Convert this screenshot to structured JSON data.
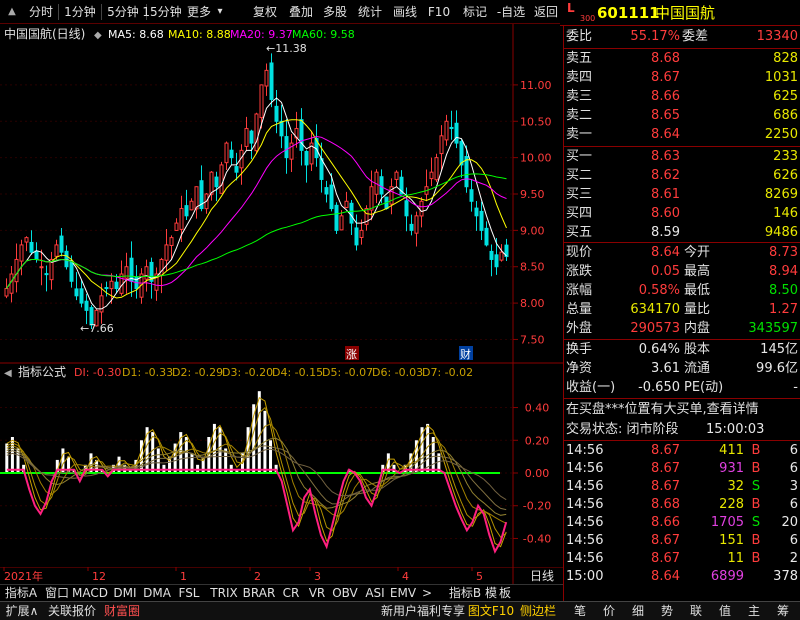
{
  "toolbar": {
    "tabs": [
      "分时",
      "1分钟",
      "5分钟",
      "15分钟",
      "更多"
    ],
    "more_arrow": "▾",
    "actions": [
      "复权",
      "叠加",
      "多股",
      "统计",
      "画线",
      "F10",
      "标记",
      "-自选",
      "返回"
    ]
  },
  "stock": {
    "market_badge": "L",
    "market_sub": "300",
    "code": "601111",
    "name": "中国国航"
  },
  "main_chart": {
    "title": "中国国航(日线)",
    "ma_labels": [
      {
        "text": "MA5: 8.68",
        "color": "#ffffff"
      },
      {
        "text": "MA10: 8.88",
        "color": "#ffff00"
      },
      {
        "text": "MA20: 9.37",
        "color": "#ff00ff"
      },
      {
        "text": "MA60: 9.58",
        "color": "#00ff00"
      }
    ],
    "high_label": "11.38",
    "low_label": "7.66",
    "y_ticks": [
      "11.00",
      "10.50",
      "10.00",
      "9.50",
      "9.00",
      "8.50",
      "8.00",
      "7.50"
    ],
    "markers": [
      "涨",
      "财"
    ]
  },
  "chart_data": [
    {
      "type": "candlestick",
      "title": "中国国航(日线)",
      "ylim": [
        7.3,
        11.7
      ],
      "y_ticks": [
        7.5,
        8.0,
        8.5,
        9.0,
        9.5,
        10.0,
        10.5,
        11.0
      ],
      "high": 11.38,
      "low": 7.66,
      "ma": {
        "MA5": 8.68,
        "MA10": 8.88,
        "MA20": 9.37,
        "MA60": 9.58
      },
      "closes": [
        8.2,
        8.4,
        8.6,
        8.8,
        8.9,
        8.7,
        8.6,
        8.5,
        8.4,
        8.6,
        8.8,
        8.7,
        8.5,
        8.3,
        8.1,
        8.0,
        7.9,
        7.7,
        7.9,
        8.1,
        8.2,
        8.3,
        8.2,
        8.4,
        8.5,
        8.3,
        8.2,
        8.4,
        8.5,
        8.3,
        8.4,
        8.6,
        8.8,
        8.9,
        9.1,
        9.3,
        9.2,
        9.4,
        9.6,
        9.3,
        9.5,
        9.8,
        9.6,
        9.9,
        10.2,
        10.0,
        9.8,
        10.1,
        10.4,
        10.2,
        10.6,
        11.0,
        11.2,
        10.8,
        10.5,
        10.3,
        10.0,
        10.2,
        10.4,
        10.1,
        9.9,
        10.2,
        10.0,
        9.7,
        9.5,
        9.3,
        9.0,
        9.2,
        9.4,
        9.1,
        8.8,
        9.0,
        9.3,
        9.6,
        9.8,
        9.5,
        9.3,
        9.6,
        9.8,
        9.5,
        9.2,
        9.0,
        9.2,
        9.4,
        9.6,
        9.8,
        10.0,
        10.3,
        10.5,
        10.4,
        10.2,
        9.9,
        9.6,
        9.4,
        9.2,
        9.0,
        8.8,
        8.6,
        8.5,
        8.7,
        8.64
      ]
    },
    {
      "type": "bar",
      "title": "指标公式",
      "ylim": [
        -0.55,
        0.55
      ],
      "y_ticks": [
        0.4,
        0.2,
        0.0,
        -0.2,
        -0.4
      ],
      "labels": [
        {
          "text": "DI: -0.30",
          "color": "#ff3c3c"
        },
        {
          "text": "D1: -0.33",
          "color": "#c8a000"
        },
        {
          "text": "D2: -0.29",
          "color": "#c8a000"
        },
        {
          "text": "D3: -0.20",
          "color": "#c8a000"
        },
        {
          "text": "D4: -0.15",
          "color": "#c8a000"
        },
        {
          "text": "D5: -0.07",
          "color": "#c8a000"
        },
        {
          "text": "D6: -0.03",
          "color": "#c8a000"
        },
        {
          "text": "D7: -0.02",
          "color": "#c8a000"
        }
      ],
      "di": [
        0.18,
        0.22,
        0.15,
        0.05,
        -0.1,
        -0.2,
        -0.25,
        -0.18,
        -0.05,
        0.08,
        0.15,
        0.1,
        0.02,
        -0.05,
        0.05,
        0.12,
        0.08,
        0.02,
        -0.02,
        0.05,
        0.1,
        0.05,
        0.02,
        0.08,
        0.2,
        0.28,
        0.25,
        0.15,
        0.05,
        0.1,
        0.18,
        0.25,
        0.22,
        0.12,
        0.05,
        0.1,
        0.22,
        0.3,
        0.28,
        0.15,
        0.05,
        0.02,
        0.12,
        0.28,
        0.42,
        0.5,
        0.38,
        0.2,
        0.05,
        -0.05,
        -0.2,
        -0.35,
        -0.3,
        -0.15,
        -0.1,
        -0.25,
        -0.38,
        -0.45,
        -0.32,
        -0.18,
        -0.05,
        0.02,
        0.0,
        -0.05,
        -0.15,
        -0.2,
        -0.1,
        0.05,
        0.12,
        0.05,
        0.0,
        0.05,
        0.12,
        0.2,
        0.28,
        0.3,
        0.22,
        0.12,
        0.0,
        -0.1,
        -0.2,
        -0.28,
        -0.35,
        -0.3,
        -0.2,
        -0.25,
        -0.38,
        -0.48,
        -0.42,
        -0.3
      ]
    }
  ],
  "indicator": {
    "title": "指标公式",
    "y_ticks": [
      "0.40",
      "0.20",
      "0.00",
      "-0.20",
      "-0.40"
    ]
  },
  "x_axis": {
    "labels": [
      "2021年",
      "12",
      "1",
      "2",
      "3",
      "4",
      "5"
    ],
    "period": "日线"
  },
  "bottom_tabs": [
    "指标A",
    "窗口",
    "MACD",
    "DMI",
    "DMA",
    "FSL",
    "TRIX",
    "BRAR",
    "CR",
    "VR",
    "OBV",
    "ASI",
    "EMV",
    "指标B",
    "模",
    "板"
  ],
  "footer": {
    "left": [
      "扩展∧",
      "关联报价",
      "财富圈"
    ],
    "promo": "新用户福利专享",
    "mid": [
      "图文F10",
      "侧边栏"
    ],
    "right": [
      "笔",
      "价",
      "细",
      "势",
      "联",
      "值",
      "主",
      "筹"
    ]
  },
  "quote": {
    "wei_bi": {
      "label": "委比",
      "value": "55.17%"
    },
    "wei_cha": {
      "label": "委差",
      "value": "13340"
    },
    "asks": [
      {
        "label": "卖五",
        "price": "8.68",
        "vol": "828"
      },
      {
        "label": "卖四",
        "price": "8.67",
        "vol": "1031"
      },
      {
        "label": "卖三",
        "price": "8.66",
        "vol": "625"
      },
      {
        "label": "卖二",
        "price": "8.65",
        "vol": "686"
      },
      {
        "label": "卖一",
        "price": "8.64",
        "vol": "2250"
      }
    ],
    "bids": [
      {
        "label": "买一",
        "price": "8.63",
        "vol": "233"
      },
      {
        "label": "买二",
        "price": "8.62",
        "vol": "626"
      },
      {
        "label": "买三",
        "price": "8.61",
        "vol": "8269"
      },
      {
        "label": "买四",
        "price": "8.60",
        "vol": "146"
      },
      {
        "label": "买五",
        "price": "8.59",
        "vol": "9486"
      }
    ],
    "stats": [
      {
        "l1": "现价",
        "v1": "8.64",
        "c1": "red",
        "l2": "今开",
        "v2": "8.73",
        "c2": "red"
      },
      {
        "l1": "涨跌",
        "v1": "0.05",
        "c1": "red",
        "l2": "最高",
        "v2": "8.94",
        "c2": "red"
      },
      {
        "l1": "涨幅",
        "v1": "0.58%",
        "c1": "red",
        "l2": "最低",
        "v2": "8.50",
        "c2": "green"
      },
      {
        "l1": "总量",
        "v1": "634170",
        "c1": "yellow",
        "l2": "量比",
        "v2": "1.27",
        "c2": "red"
      },
      {
        "l1": "外盘",
        "v1": "290573",
        "c1": "red",
        "l2": "内盘",
        "v2": "343597",
        "c2": "green"
      }
    ],
    "stats2": [
      {
        "l1": "换手",
        "v1": "0.64%",
        "l2": "股本",
        "v2": "145亿"
      },
      {
        "l1": "净资",
        "v1": "3.61",
        "l2": "流通",
        "v2": "99.6亿"
      },
      {
        "l1": "收益(一)",
        "v1": "-0.650",
        "l2": "PE(动)",
        "v2": "-"
      }
    ],
    "notice": "在买盘***位置有大买单,查看详情",
    "status_label": "交易状态: 闭市阶段",
    "status_time": "15:00:03",
    "ticks": [
      {
        "t": "14:56",
        "p": "8.67",
        "v": "411",
        "s": "B",
        "n": "6"
      },
      {
        "t": "14:56",
        "p": "8.67",
        "v": "931",
        "s": "B",
        "n": "6"
      },
      {
        "t": "14:56",
        "p": "8.67",
        "v": "32",
        "s": "S",
        "n": "3"
      },
      {
        "t": "14:56",
        "p": "8.68",
        "v": "228",
        "s": "B",
        "n": "6"
      },
      {
        "t": "14:56",
        "p": "8.66",
        "v": "1705",
        "s": "S",
        "n": "20"
      },
      {
        "t": "14:56",
        "p": "8.67",
        "v": "151",
        "s": "B",
        "n": "6"
      },
      {
        "t": "14:56",
        "p": "8.67",
        "v": "11",
        "s": "B",
        "n": "2"
      },
      {
        "t": "15:00",
        "p": "8.64",
        "v": "6899",
        "s": "",
        "n": "378"
      }
    ]
  },
  "colors": {
    "up": "#ff3c3c",
    "down": "#00e0e0",
    "ma5": "#ffffff",
    "ma10": "#ffff00",
    "ma20": "#ff00ff",
    "ma60": "#00ff00",
    "border": "#8a0000"
  }
}
